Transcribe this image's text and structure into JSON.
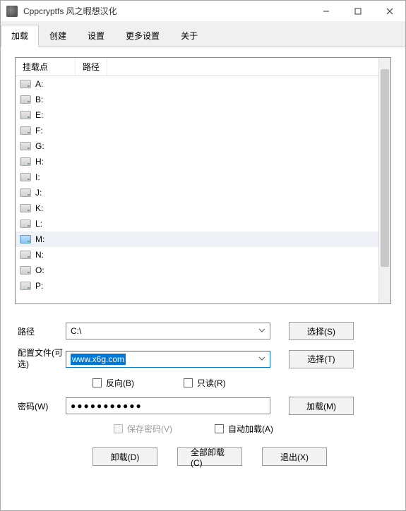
{
  "window": {
    "title": "Cppcryptfs 风之暇想汉化"
  },
  "tabs": [
    {
      "label": "加载",
      "active": true
    },
    {
      "label": "创建"
    },
    {
      "label": "设置"
    },
    {
      "label": "更多设置"
    },
    {
      "label": "关于"
    }
  ],
  "list": {
    "headers": {
      "mount": "挂载点",
      "path": "路径"
    },
    "drives": [
      {
        "letter": "A:"
      },
      {
        "letter": "B:"
      },
      {
        "letter": "E:"
      },
      {
        "letter": "F:"
      },
      {
        "letter": "G:"
      },
      {
        "letter": "H:"
      },
      {
        "letter": "I:"
      },
      {
        "letter": "J:"
      },
      {
        "letter": "K:"
      },
      {
        "letter": "L:"
      },
      {
        "letter": "M:",
        "selected": true
      },
      {
        "letter": "N:"
      },
      {
        "letter": "O:"
      },
      {
        "letter": "P:"
      }
    ]
  },
  "form": {
    "path_label": "路径",
    "path_value": "C:\\",
    "select_s": "选择(S)",
    "config_label": "配置文件(可选)",
    "config_value": "www.x6g.com",
    "select_t": "选择(T)",
    "reverse": "反向(B)",
    "readonly": "只读(R)",
    "password_label": "密码(W)",
    "password_value": "●●●●●●●●●●●",
    "mount": "加载(M)",
    "save_pw": "保存密码(V)",
    "automount": "自动加载(A)",
    "dismount": "卸载(D)",
    "dismount_all": "全部卸载(C)",
    "exit": "退出(X)"
  }
}
